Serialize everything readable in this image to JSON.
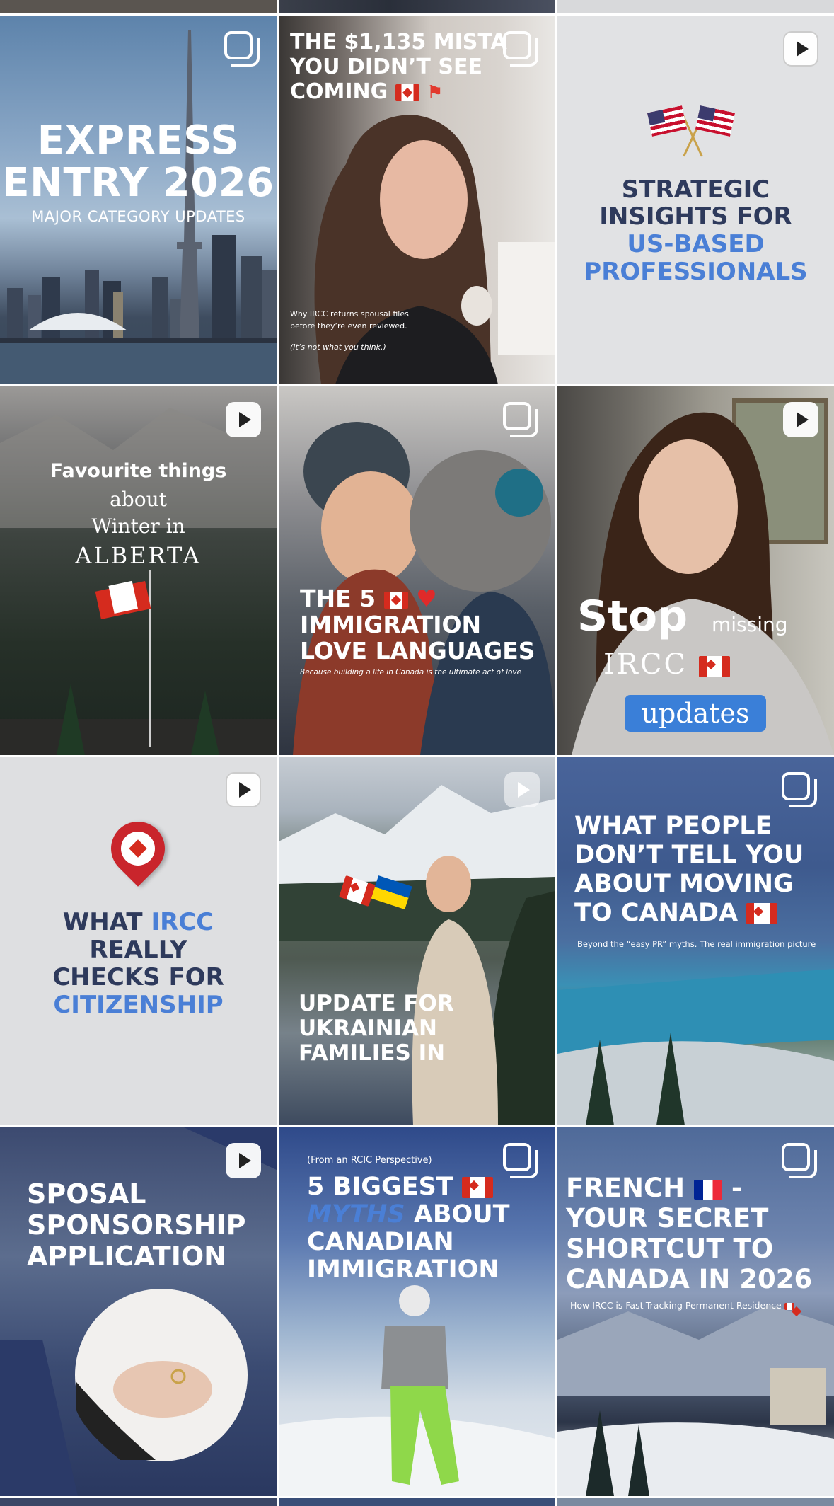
{
  "tiles": [
    {
      "id": "express-entry",
      "type": "carousel",
      "title_l1": "EXPRESS",
      "title_l2": "ENTRY 2026",
      "subtitle": "MAJOR CATEGORY UPDATES"
    },
    {
      "id": "mistake",
      "type": "carousel",
      "title_l1": "THE $1,135 MISTA",
      "title_l2": "YOU DIDN’T SEE",
      "title_l3": "COMING",
      "caption_l1": "Why IRCC returns spousal files",
      "caption_l2": "before they’re even reviewed.",
      "caption_l3": "(It’s not what you think.)"
    },
    {
      "id": "strategic",
      "type": "reel",
      "title_l1": "STRATEGIC",
      "title_l2": "INSIGHTS FOR",
      "title_l3": "US-BASED",
      "title_l4": "PROFESSIONALS"
    },
    {
      "id": "alberta",
      "type": "reel",
      "title_l1": "Favourite things",
      "title_l2": "about",
      "title_l3": "Winter in",
      "title_l4": "ALBERTA"
    },
    {
      "id": "love-languages",
      "type": "carousel",
      "title_l1": "THE 5",
      "title_l2": "IMMIGRATION",
      "title_l3": "LOVE LANGUAGES",
      "subtitle": "Because building a life in Canada is the ultimate act of love"
    },
    {
      "id": "stop-missing",
      "type": "reel",
      "word_stop": "Stop",
      "word_missing": "missing",
      "word_ircc": "IRCC",
      "word_updates": "updates"
    },
    {
      "id": "citizenship",
      "type": "reel",
      "title_l1a": "WHAT ",
      "title_l1b": "IRCC",
      "title_l2": "REALLY",
      "title_l3": "CHECKS FOR",
      "title_l4": "CITIZENSHIP"
    },
    {
      "id": "ukrainian",
      "type": "reel",
      "title_l1": "UPDATE FOR",
      "title_l2": "UKRAINIAN",
      "title_l3": "FAMILIES IN"
    },
    {
      "id": "moving",
      "type": "carousel",
      "title_l1": "WHAT PEOPLE",
      "title_l2": "DON’T TELL YOU",
      "title_l3": "ABOUT MOVING",
      "title_l4": "TO CANADA",
      "subtitle": "Beyond the “easy PR” myths. The real immigration picture"
    },
    {
      "id": "sposal",
      "type": "reel",
      "title_l1": "SPOSAL",
      "title_l2": "SPONSORSHIP",
      "title_l3": "APPLICATION"
    },
    {
      "id": "myths",
      "type": "carousel",
      "kicker": "(From an RCIC Perspective)",
      "title_l1": "5 BIGGEST",
      "title_l2a": "MYTHS",
      "title_l2b": " ABOUT",
      "title_l3": "CANADIAN",
      "title_l4": "IMMIGRATION"
    },
    {
      "id": "french",
      "type": "carousel",
      "title_l1": "FRENCH",
      "title_l1b": " -",
      "title_l2": "YOUR SECRET",
      "title_l3": "SHORTCUT TO",
      "title_l4": "CANADA IN 2026",
      "subtitle": "How IRCC is Fast-Tracking Permanent Residence"
    }
  ],
  "colors": {
    "accent_blue": "#4a7fd6",
    "navy_text": "#2e3a5c",
    "light_tile_bg": "#e1e2e4",
    "canada_red": "#d52b1e"
  },
  "icons": {
    "reel": "reel-icon",
    "carousel": "carousel-icon"
  }
}
